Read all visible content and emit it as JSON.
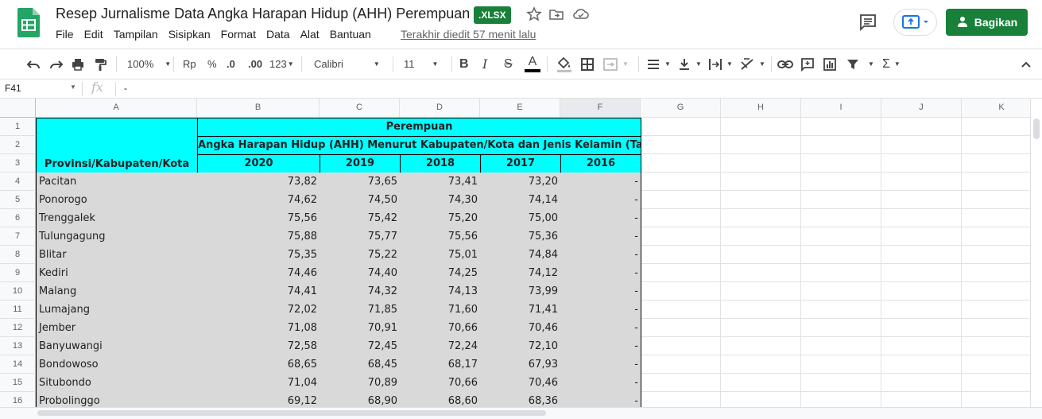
{
  "app": {
    "title": "Resep Jurnalisme Data Angka Harapan Hidup (AHH) Perempuan",
    "badge": ".XLSX",
    "menu": [
      "File",
      "Edit",
      "Tampilan",
      "Sisipkan",
      "Format",
      "Data",
      "Alat",
      "Bantuan"
    ],
    "last_edit": "Terakhir diedit 57 menit lalu",
    "share_label": "Bagikan"
  },
  "toolbar": {
    "zoom": "100%",
    "currency": "Rp",
    "percent": "%",
    "decrease_decimal": ".0",
    "increase_decimal": ".00",
    "number_format": "123",
    "font": "Calibri",
    "font_size": "11",
    "bold": "B",
    "italic": "I",
    "strike": "S",
    "text_color": "A"
  },
  "formula_bar": {
    "cell_ref": "F41",
    "fx": "fx",
    "content": "-"
  },
  "columns": [
    "A",
    "B",
    "C",
    "D",
    "E",
    "F",
    "G",
    "H",
    "I",
    "J",
    "K"
  ],
  "sheet": {
    "header_row1": "Perempuan",
    "header_row2": "Angka Harapan Hidup (AHH) Menurut Kabupaten/Kota dan Jenis Kelamin (Tahun)",
    "row_label_header": "Provinsi/Kabupaten/Kota",
    "years": [
      "2020",
      "2019",
      "2018",
      "2017",
      "2016"
    ],
    "rows": [
      {
        "num": "4",
        "name": "Pacitan",
        "v": [
          "73,82",
          "73,65",
          "73,41",
          "73,20",
          "-"
        ]
      },
      {
        "num": "5",
        "name": "Ponorogo",
        "v": [
          "74,62",
          "74,50",
          "74,30",
          "74,14",
          "-"
        ]
      },
      {
        "num": "6",
        "name": "Trenggalek",
        "v": [
          "75,56",
          "75,42",
          "75,20",
          "75,00",
          "-"
        ]
      },
      {
        "num": "7",
        "name": "Tulungagung",
        "v": [
          "75,88",
          "75,77",
          "75,56",
          "75,36",
          "-"
        ]
      },
      {
        "num": "8",
        "name": "Blitar",
        "v": [
          "75,35",
          "75,22",
          "75,01",
          "74,84",
          "-"
        ]
      },
      {
        "num": "9",
        "name": "Kediri",
        "v": [
          "74,46",
          "74,40",
          "74,25",
          "74,12",
          "-"
        ]
      },
      {
        "num": "10",
        "name": "Malang",
        "v": [
          "74,41",
          "74,32",
          "74,13",
          "73,99",
          "-"
        ]
      },
      {
        "num": "11",
        "name": "Lumajang",
        "v": [
          "72,02",
          "71,85",
          "71,60",
          "71,41",
          "-"
        ]
      },
      {
        "num": "12",
        "name": "Jember",
        "v": [
          "71,08",
          "70,91",
          "70,66",
          "70,46",
          "-"
        ]
      },
      {
        "num": "13",
        "name": "Banyuwangi",
        "v": [
          "72,58",
          "72,45",
          "72,24",
          "72,10",
          "-"
        ]
      },
      {
        "num": "14",
        "name": "Bondowoso",
        "v": [
          "68,65",
          "68,45",
          "68,17",
          "67,93",
          "-"
        ]
      },
      {
        "num": "15",
        "name": "Situbondo",
        "v": [
          "71,04",
          "70,89",
          "70,66",
          "70,46",
          "-"
        ]
      },
      {
        "num": "16",
        "name": "Probolinggo",
        "v": [
          "69,12",
          "68,90",
          "68,60",
          "68,36",
          "-"
        ]
      }
    ]
  },
  "row_numbers_top": [
    "1",
    "2",
    "3"
  ],
  "colors": {
    "header_fill": "#00ffff",
    "data_fill": "#d9d9d9",
    "brand_green": "#188038"
  }
}
